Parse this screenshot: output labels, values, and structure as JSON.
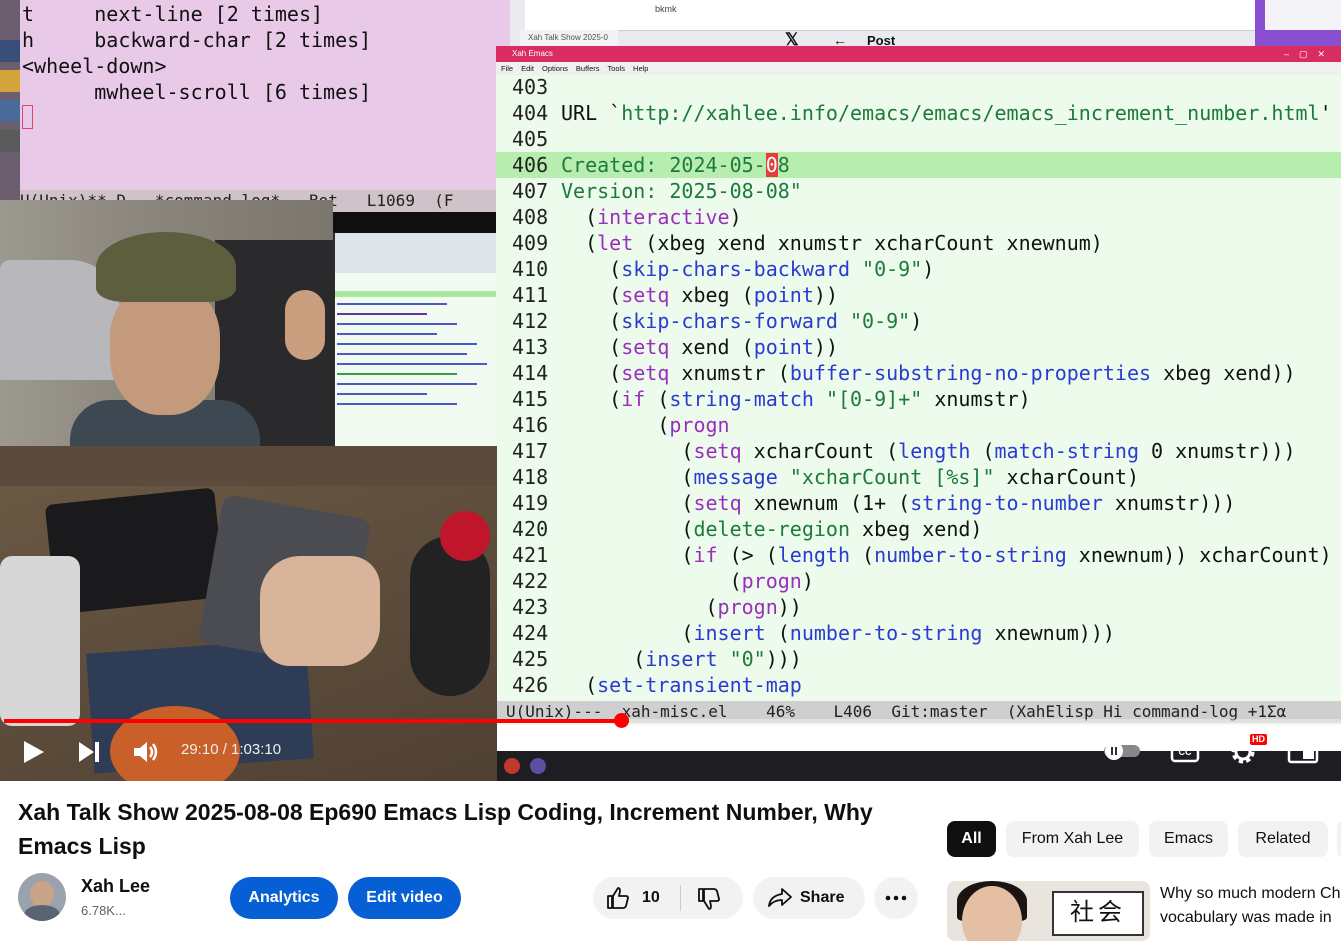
{
  "video": {
    "command_log": {
      "lines": [
        "t     next-line [2 times]",
        "h     backward-char [2 times]",
        "<wheel-down>",
        "      mwheel-scroll [6 times]"
      ],
      "modeline": "U(Unix)** D   *command-log*   Bot   L1069  (F"
    },
    "browser": {
      "bookmark": "bkmk",
      "tab_label": "Xah Talk Show 2025-0",
      "x_logo": "𝕏",
      "back_arrow": "←",
      "post_heading": "Post"
    },
    "emacs": {
      "title": "Xah Emacs",
      "menu": [
        "File",
        "Edit",
        "Options",
        "Buffers",
        "Tools",
        "Help"
      ],
      "lines": [
        {
          "n": "403",
          "parts": [
            {
              "t": "",
              "c": "dark"
            }
          ]
        },
        {
          "n": "404",
          "parts": [
            {
              "t": "URL `",
              "c": "dark"
            },
            {
              "t": "http://xahlee.info/emacs/emacs/emacs_increment_number.html",
              "c": "str"
            },
            {
              "t": "'",
              "c": "dark"
            }
          ]
        },
        {
          "n": "405",
          "parts": [
            {
              "t": "",
              "c": "dark"
            }
          ]
        },
        {
          "n": "406",
          "parts": [
            {
              "t": "Created: 2024-05-",
              "c": "str"
            },
            {
              "t": "0",
              "c": "curs"
            },
            {
              "t": "8",
              "c": "str"
            }
          ]
        },
        {
          "n": "407",
          "parts": [
            {
              "t": "Version: 2025-08-08\"",
              "c": "str"
            }
          ]
        },
        {
          "n": "408",
          "parts": [
            {
              "t": "  (",
              "c": "dark"
            },
            {
              "t": "interactive",
              "c": "kw"
            },
            {
              "t": ")",
              "c": "dark"
            }
          ]
        },
        {
          "n": "409",
          "parts": [
            {
              "t": "  (",
              "c": "dark"
            },
            {
              "t": "let",
              "c": "kw"
            },
            {
              "t": " (xbeg xend xnumstr xcharCount xnewnum)",
              "c": "dark"
            }
          ]
        },
        {
          "n": "410",
          "parts": [
            {
              "t": "    (",
              "c": "dark"
            },
            {
              "t": "skip-chars-backward",
              "c": "fn"
            },
            {
              "t": " ",
              "c": "dark"
            },
            {
              "t": "\"0-9\"",
              "c": "str"
            },
            {
              "t": ")",
              "c": "dark"
            }
          ]
        },
        {
          "n": "411",
          "parts": [
            {
              "t": "    (",
              "c": "dark"
            },
            {
              "t": "setq",
              "c": "kw"
            },
            {
              "t": " xbeg (",
              "c": "dark"
            },
            {
              "t": "point",
              "c": "fn"
            },
            {
              "t": "))",
              "c": "dark"
            }
          ]
        },
        {
          "n": "412",
          "parts": [
            {
              "t": "    (",
              "c": "dark"
            },
            {
              "t": "skip-chars-forward",
              "c": "fn"
            },
            {
              "t": " ",
              "c": "dark"
            },
            {
              "t": "\"0-9\"",
              "c": "str"
            },
            {
              "t": ")",
              "c": "dark"
            }
          ]
        },
        {
          "n": "413",
          "parts": [
            {
              "t": "    (",
              "c": "dark"
            },
            {
              "t": "setq",
              "c": "kw"
            },
            {
              "t": " xend (",
              "c": "dark"
            },
            {
              "t": "point",
              "c": "fn"
            },
            {
              "t": "))",
              "c": "dark"
            }
          ]
        },
        {
          "n": "414",
          "parts": [
            {
              "t": "    (",
              "c": "dark"
            },
            {
              "t": "setq",
              "c": "kw"
            },
            {
              "t": " xnumstr (",
              "c": "dark"
            },
            {
              "t": "buffer-substring-no-properties",
              "c": "fn"
            },
            {
              "t": " xbeg xend))",
              "c": "dark"
            }
          ]
        },
        {
          "n": "415",
          "parts": [
            {
              "t": "    (",
              "c": "dark"
            },
            {
              "t": "if",
              "c": "kw"
            },
            {
              "t": " (",
              "c": "dark"
            },
            {
              "t": "string-match",
              "c": "fn"
            },
            {
              "t": " ",
              "c": "dark"
            },
            {
              "t": "\"[0-9]+\"",
              "c": "str"
            },
            {
              "t": " xnumstr)",
              "c": "dark"
            }
          ]
        },
        {
          "n": "416",
          "parts": [
            {
              "t": "        (",
              "c": "dark"
            },
            {
              "t": "progn",
              "c": "kw"
            }
          ]
        },
        {
          "n": "417",
          "parts": [
            {
              "t": "          (",
              "c": "dark"
            },
            {
              "t": "setq",
              "c": "kw"
            },
            {
              "t": " xcharCount (",
              "c": "dark"
            },
            {
              "t": "length",
              "c": "fn"
            },
            {
              "t": " (",
              "c": "dark"
            },
            {
              "t": "match-string",
              "c": "fn"
            },
            {
              "t": " 0 xnumstr)))",
              "c": "dark"
            }
          ]
        },
        {
          "n": "418",
          "parts": [
            {
              "t": "          (",
              "c": "dark"
            },
            {
              "t": "message",
              "c": "fn"
            },
            {
              "t": " ",
              "c": "dark"
            },
            {
              "t": "\"xcharCount [%s]\"",
              "c": "str"
            },
            {
              "t": " xcharCount)",
              "c": "dark"
            }
          ]
        },
        {
          "n": "419",
          "parts": [
            {
              "t": "          (",
              "c": "dark"
            },
            {
              "t": "setq",
              "c": "kw"
            },
            {
              "t": " xnewnum (1+ (",
              "c": "dark"
            },
            {
              "t": "string-to-number",
              "c": "fn"
            },
            {
              "t": " xnumstr)))",
              "c": "dark"
            }
          ]
        },
        {
          "n": "420",
          "parts": [
            {
              "t": "          (",
              "c": "dark"
            },
            {
              "t": "delete-region",
              "c": "str"
            },
            {
              "t": " xbeg xend)",
              "c": "dark"
            }
          ]
        },
        {
          "n": "421",
          "parts": [
            {
              "t": "          (",
              "c": "dark"
            },
            {
              "t": "if",
              "c": "kw"
            },
            {
              "t": " (> (",
              "c": "dark"
            },
            {
              "t": "length",
              "c": "fn"
            },
            {
              "t": " (",
              "c": "dark"
            },
            {
              "t": "number-to-string",
              "c": "fn"
            },
            {
              "t": " xnewnum)) xcharCount)",
              "c": "dark"
            }
          ]
        },
        {
          "n": "422",
          "parts": [
            {
              "t": "              (",
              "c": "dark"
            },
            {
              "t": "progn",
              "c": "kw"
            },
            {
              "t": ")",
              "c": "dark"
            }
          ]
        },
        {
          "n": "423",
          "parts": [
            {
              "t": "            (",
              "c": "dark"
            },
            {
              "t": "progn",
              "c": "kw"
            },
            {
              "t": "))",
              "c": "dark"
            }
          ]
        },
        {
          "n": "424",
          "parts": [
            {
              "t": "          (",
              "c": "dark"
            },
            {
              "t": "insert",
              "c": "fn"
            },
            {
              "t": " (",
              "c": "dark"
            },
            {
              "t": "number-to-string",
              "c": "fn"
            },
            {
              "t": " xnewnum)))",
              "c": "dark"
            }
          ]
        },
        {
          "n": "425",
          "parts": [
            {
              "t": "      (",
              "c": "dark"
            },
            {
              "t": "insert",
              "c": "fn"
            },
            {
              "t": " ",
              "c": "dark"
            },
            {
              "t": "\"0\"",
              "c": "str"
            },
            {
              "t": ")))",
              "c": "dark"
            }
          ]
        },
        {
          "n": "426",
          "parts": [
            {
              "t": "  (",
              "c": "dark"
            },
            {
              "t": "set-transient-map",
              "c": "fn"
            }
          ]
        }
      ],
      "modeline": "U(Unix)---  xah-misc.el    46%    L406  Git:master  (XahElisp Hi command-log +1Σα"
    },
    "player": {
      "time": "29:10 / 1:03:10",
      "progress": 0.4617,
      "hd_badge": "HD"
    }
  },
  "title": "Xah Talk Show 2025-08-08 Ep690 Emacs Lisp Coding, Increment Number, Why Emacs Lisp",
  "channel": {
    "name": "Xah Lee",
    "subscribers": "6.78K..."
  },
  "actions": {
    "analytics": "Analytics",
    "edit_video": "Edit video",
    "likes": "10",
    "share": "Share"
  },
  "chips": [
    "All",
    "From Xah Lee",
    "Emacs",
    "Related"
  ],
  "recommendation": {
    "title_line1": "Why so much modern Ch",
    "title_line2": "vocabulary was made in",
    "thumb_text": "社会"
  }
}
